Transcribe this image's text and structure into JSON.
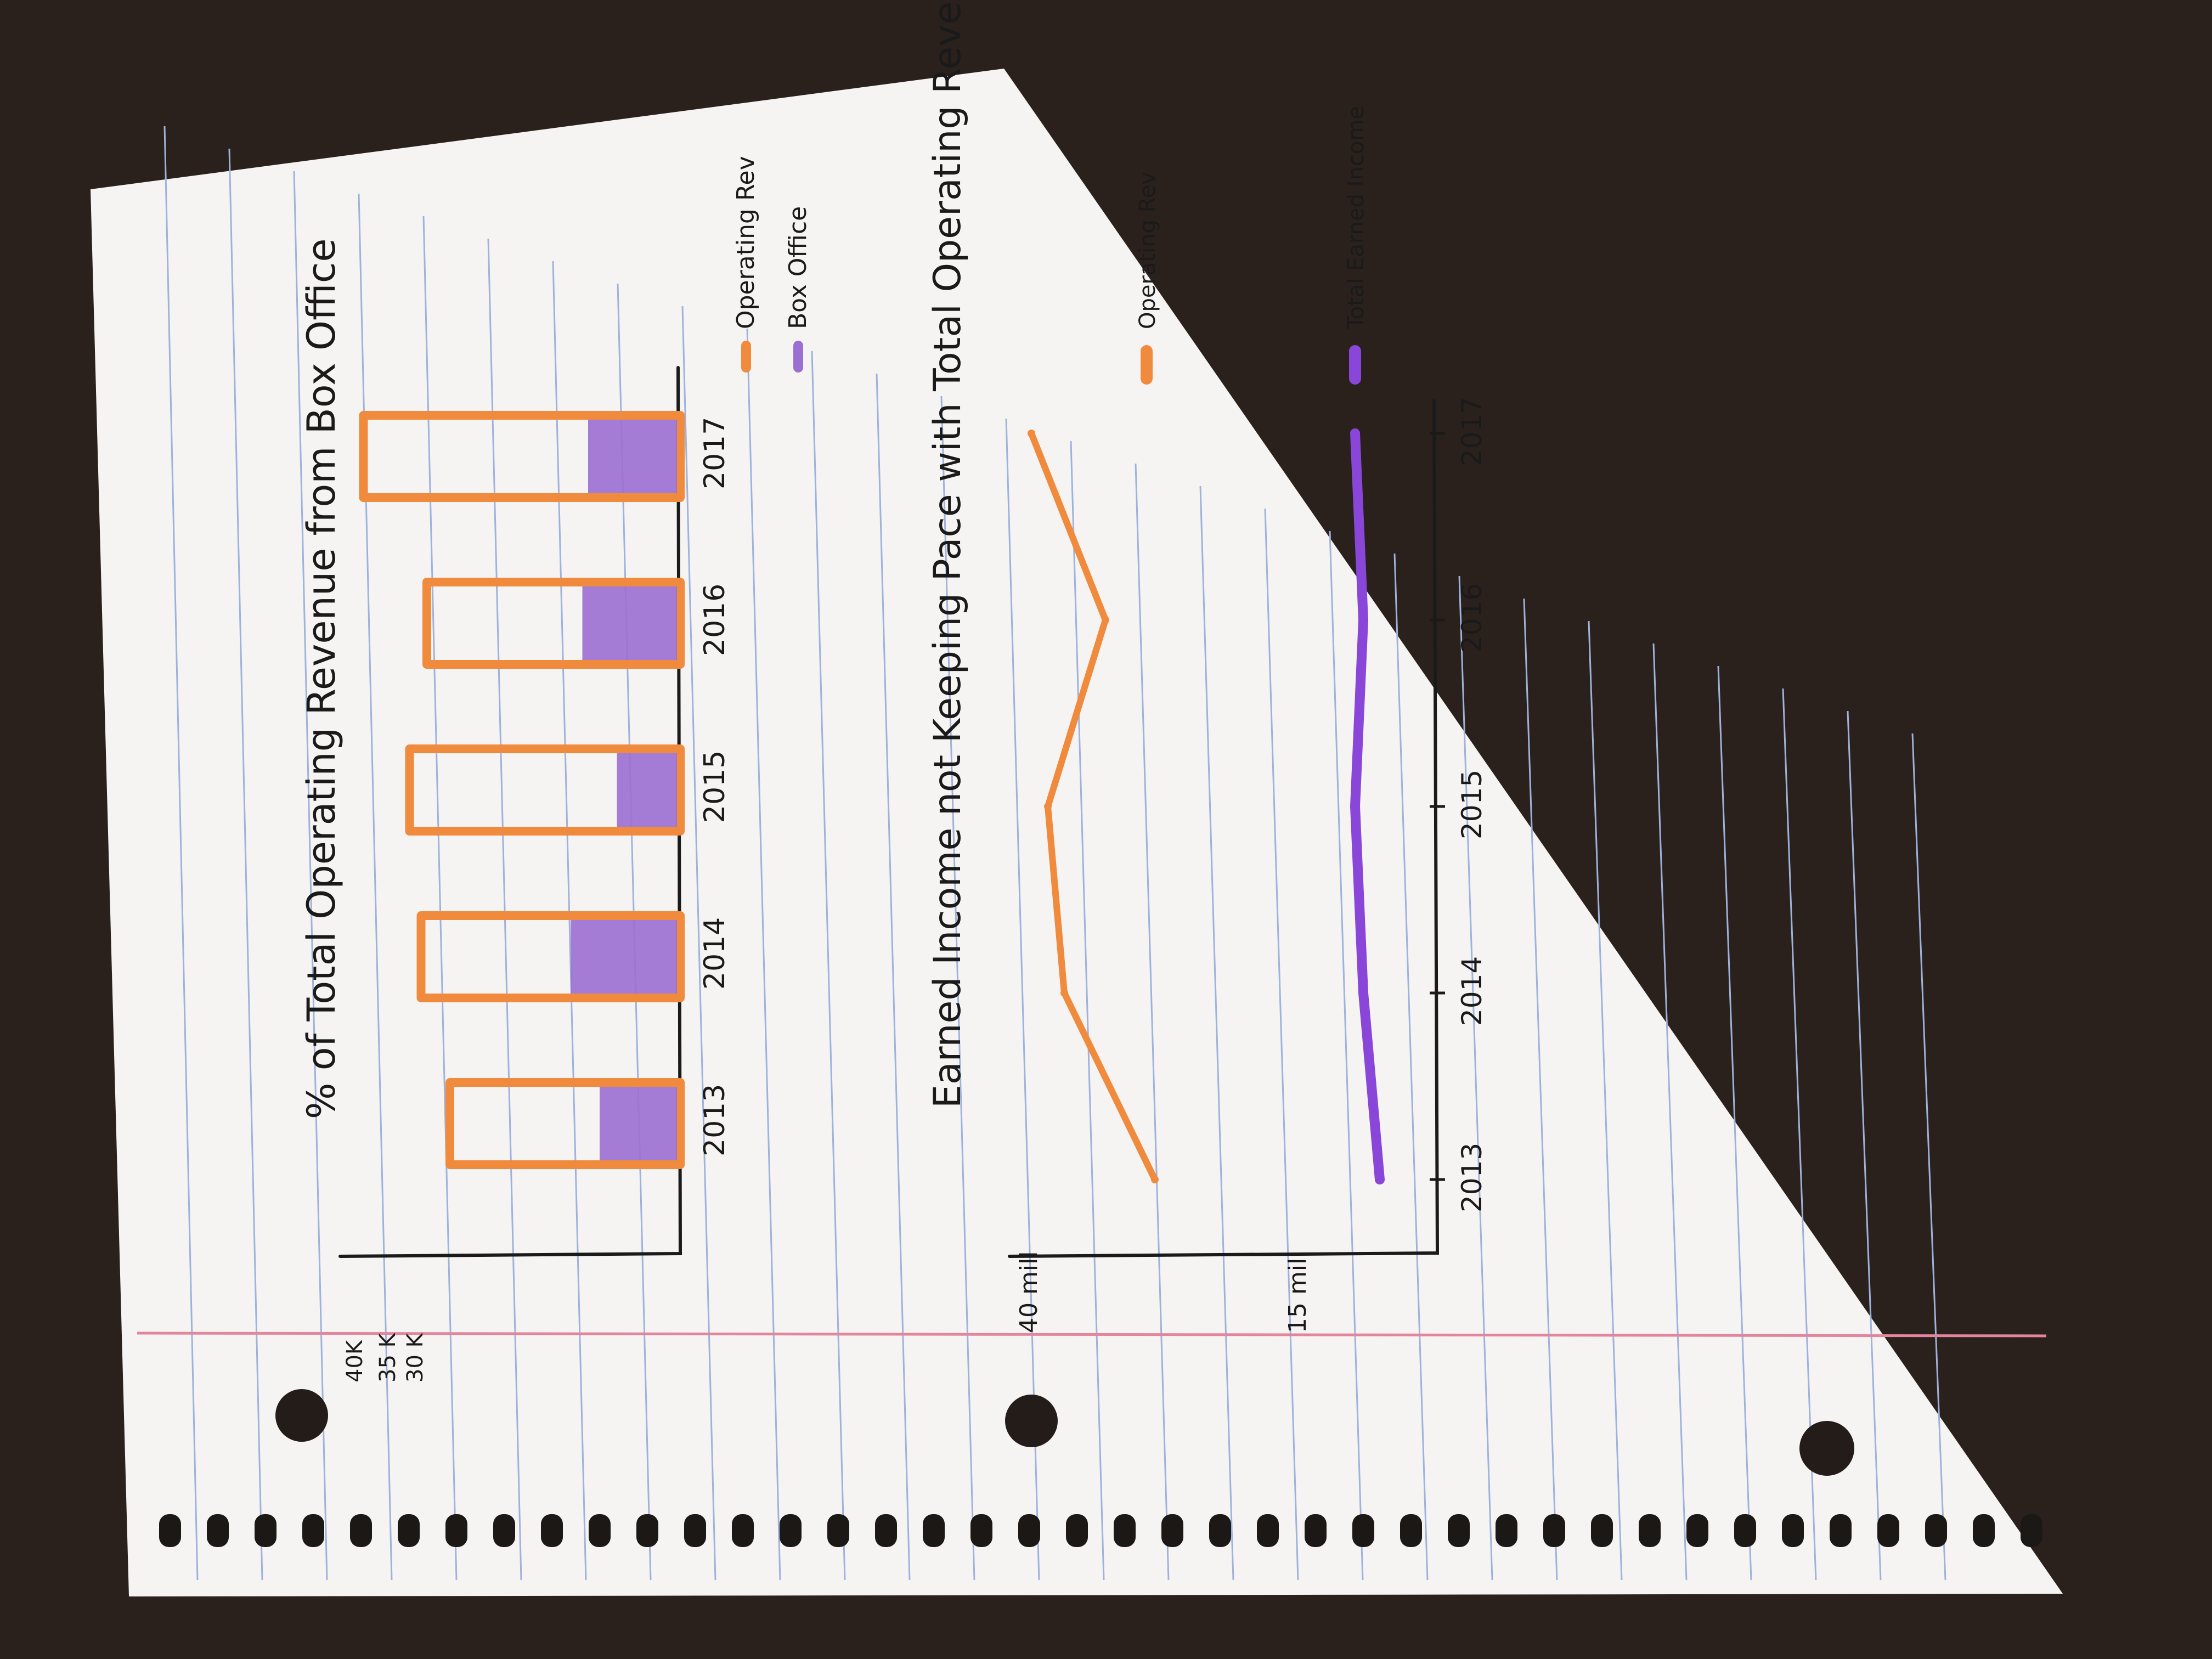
{
  "colors": {
    "table": "#2a211c",
    "paper": "#f6f4f2",
    "ruled_line": "#9fb2dc",
    "margin_line": "#e3869d",
    "ink": "#1a1a1a",
    "operating": "#f08a3c",
    "box_office": "#9b6fd2",
    "earned": "#8a46d8"
  },
  "chart_data": [
    {
      "type": "bar",
      "title": "% of Total Operating Revenue from Box Office",
      "categories": [
        "2013",
        "2014",
        "2015",
        "2016",
        "2017"
      ],
      "yticks": [
        "40K",
        "35 K",
        "30 K"
      ],
      "series": [
        {
          "name": "Operating Rev",
          "values": [
            40,
            45,
            47,
            44,
            55
          ],
          "style": "outline"
        },
        {
          "name": "Box Office",
          "values": [
            14,
            19,
            11,
            17,
            16
          ],
          "style": "filled"
        }
      ],
      "legend": [
        {
          "label": "Operating Rev",
          "color_key": "operating"
        },
        {
          "label": "Box Office",
          "color_key": "box_office"
        }
      ],
      "legend_position": "below-right",
      "xlabel": "",
      "ylabel": ""
    },
    {
      "type": "line",
      "title": "Earned Income not Keeping Pace with Total Operating Revenue",
      "x": [
        "2013",
        "2014",
        "2015",
        "2016",
        "2017"
      ],
      "x_axis_labels": [
        "2013",
        "2014",
        "2015",
        "2016",
        "2017"
      ],
      "ytick_labels": [
        "40 mill",
        "15 mill"
      ],
      "series": [
        {
          "name": "Operating Rev",
          "values": [
            35,
            46,
            48,
            41,
            50
          ]
        },
        {
          "name": "Total Earned Income",
          "values": [
            17,
            19,
            20,
            19,
            20
          ]
        }
      ],
      "legend": [
        {
          "label": "Operating Rev",
          "color_key": "operating"
        },
        {
          "label": "Total Earned Income",
          "color_key": "earned"
        }
      ],
      "legend_position": "right",
      "xlabel": "",
      "ylabel": ""
    }
  ]
}
